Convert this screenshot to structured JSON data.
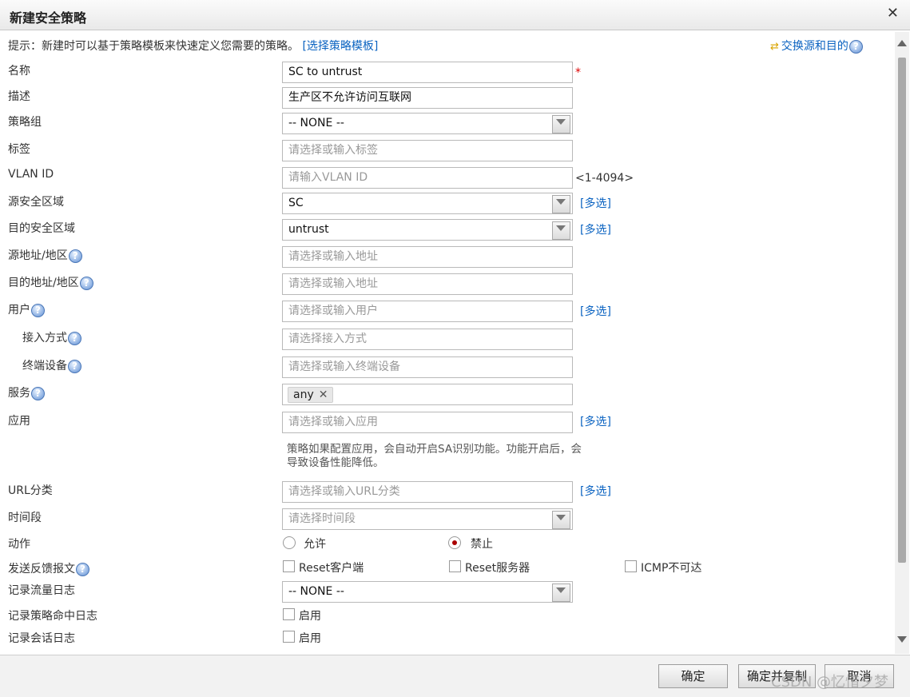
{
  "dialog": {
    "title": "新建安全策略"
  },
  "hint": {
    "text": "提示：新建时可以基于策略模板来快速定义您需要的策略。",
    "template_link": "[选择策略模板]",
    "swap_label": "交换源和目的"
  },
  "labels": {
    "name": "名称",
    "desc": "描述",
    "group": "策略组",
    "tag": "标签",
    "vlan": "VLAN ID",
    "src_zone": "源安全区域",
    "dst_zone": "目的安全区域",
    "src_addr": "源地址/地区",
    "dst_addr": "目的地址/地区",
    "user": "用户",
    "access": "接入方式",
    "terminal": "终端设备",
    "service": "服务",
    "app": "应用",
    "url": "URL分类",
    "time": "时间段",
    "action": "动作",
    "feedback": "发送反馈报文",
    "traffic_log": "记录流量日志",
    "hit_log": "记录策略命中日志",
    "session_log": "记录会话日志"
  },
  "fields": {
    "name_value": "SC to untrust",
    "desc_value": "生产区不允许访问互联网",
    "group_value": "-- NONE --",
    "tag_placeholder": "请选择或输入标签",
    "vlan_placeholder": "请输入VLAN ID",
    "vlan_range": "<1-4094>",
    "src_zone_value": "SC",
    "dst_zone_value": "untrust",
    "src_addr_placeholder": "请选择或输入地址",
    "dst_addr_placeholder": "请选择或输入地址",
    "user_placeholder": "请选择或输入用户",
    "access_placeholder": "请选择接入方式",
    "terminal_placeholder": "请选择或输入终端设备",
    "service_tag": "any",
    "app_placeholder": "请选择或输入应用",
    "app_note": "策略如果配置应用，会自动开启SA识别功能。功能开启后，会导致设备性能降低。",
    "url_placeholder": "请选择或输入URL分类",
    "time_placeholder": "请选择时间段",
    "traffic_log_value": "-- NONE --"
  },
  "required_mark": "*",
  "multi_select": "[多选]",
  "action": {
    "permit": "允许",
    "deny": "禁止",
    "selected": "deny"
  },
  "feedback": {
    "reset_client": "Reset客户端",
    "reset_server": "Reset服务器",
    "icmp": "ICMP不可达"
  },
  "enable_label": "启用",
  "buttons": {
    "ok": "确定",
    "ok_copy": "确定并复制",
    "cancel": "取消"
  },
  "watermark": "CSDN @忆惜夕梦",
  "colors": {
    "link": "#0b63c1",
    "required": "#dd0000",
    "radio_selected": "#aa0000"
  }
}
